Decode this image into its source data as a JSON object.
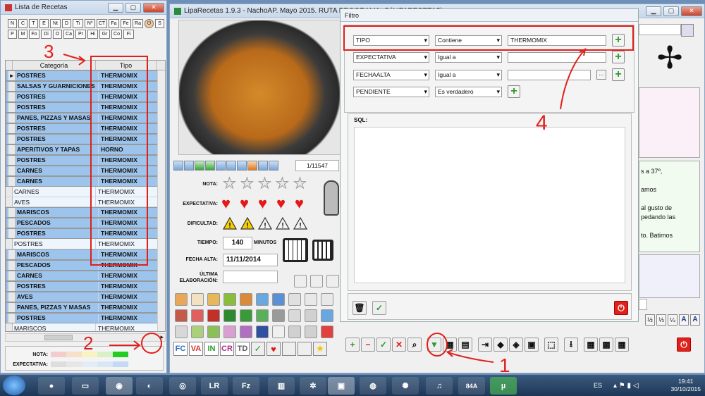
{
  "lista": {
    "title": "Lista de Recetas",
    "letters": [
      "N",
      "C",
      "T",
      "E",
      "Nt",
      "D",
      "Ti",
      "Nº",
      "CT",
      "Fa",
      "Fe",
      "Ra",
      "S",
      "P",
      "M",
      "Fo",
      "Di",
      "O",
      "Ca",
      "Pr",
      "Hi",
      "Gr",
      "Co",
      "Fi"
    ],
    "columns": [
      "Categoría",
      "Tipo"
    ],
    "rows": [
      {
        "cat": "POSTRES",
        "tipo": "THERMOMIX",
        "style": "sel"
      },
      {
        "cat": "SALSAS Y GUARNICIONES",
        "tipo": "THERMOMIX",
        "style": "sel"
      },
      {
        "cat": "POSTRES",
        "tipo": "THERMOMIX",
        "style": "sel"
      },
      {
        "cat": "POSTRES",
        "tipo": "THERMOMIX",
        "style": "sel"
      },
      {
        "cat": "PANES, PIZZAS Y MASAS",
        "tipo": "THERMOMIX",
        "style": "sel"
      },
      {
        "cat": "POSTRES",
        "tipo": "THERMOMIX",
        "style": "sel"
      },
      {
        "cat": "POSTRES",
        "tipo": "THERMOMIX",
        "style": "sel"
      },
      {
        "cat": "APERITIVOS Y TAPAS",
        "tipo": "HORNO",
        "style": "sel"
      },
      {
        "cat": "POSTRES",
        "tipo": "THERMOMIX",
        "style": "sel"
      },
      {
        "cat": "CARNES",
        "tipo": "THERMOMIX",
        "style": "sel"
      },
      {
        "cat": "CARNES",
        "tipo": "THERMOMIX",
        "style": "sel"
      },
      {
        "cat": "CARNES",
        "tipo": "THERMOMIX",
        "style": "plain"
      },
      {
        "cat": "AVES",
        "tipo": "THERMOMIX",
        "style": "plain"
      },
      {
        "cat": "MARISCOS",
        "tipo": "THERMOMIX",
        "style": "sel"
      },
      {
        "cat": "PESCADOS",
        "tipo": "THERMOMIX",
        "style": "sel"
      },
      {
        "cat": "POSTRES",
        "tipo": "THERMOMIX",
        "style": "sel"
      },
      {
        "cat": "POSTRES",
        "tipo": "THERMOMIX",
        "style": "plain"
      },
      {
        "cat": "MARISCOS",
        "tipo": "THERMOMIX",
        "style": "sel"
      },
      {
        "cat": "PESCADOS",
        "tipo": "THERMOMIX",
        "style": "sel"
      },
      {
        "cat": "CARNES",
        "tipo": "THERMOMIX",
        "style": "sel"
      },
      {
        "cat": "POSTRES",
        "tipo": "THERMOMIX",
        "style": "sel"
      },
      {
        "cat": "AVES",
        "tipo": "THERMOMIX",
        "style": "sel"
      },
      {
        "cat": "PANES, PIZZAS Y MASAS",
        "tipo": "THERMOMIX",
        "style": "sel"
      },
      {
        "cat": "POSTRES",
        "tipo": "THERMOMIX",
        "style": "sel"
      },
      {
        "cat": "MARISCOS",
        "tipo": "THERMOMIX",
        "style": "plain"
      }
    ],
    "legend": {
      "nota": "NOTA:",
      "expectativa": "EXPECTATIVA:"
    }
  },
  "main": {
    "title": "LipaRecetas 1.9.3 - NachoAP. Mayo 2015. RUTA PROGRAMA: C:\\LIPARECETAS\\",
    "counter": "1/11547",
    "labels": {
      "nota": "NOTA:",
      "expectativa": "EXPECTATIVA:",
      "dificultad": "DIFICULTAD:",
      "tiempo": "TIEMPO:",
      "minutos": "MINUTOS",
      "fecha_alta": "FECHA ALTA:",
      "ultima_elaboracion": "ÚLTIMA ELABORACIÓN:"
    },
    "tiempo_value": "140",
    "fecha_alta_value": "11/11/2014",
    "ultima_elaboracion_value": "",
    "nota_stars": 0,
    "expectativa_hearts": 5,
    "tags": [
      "FC",
      "VA",
      "IN",
      "CR",
      "TD"
    ]
  },
  "filtro": {
    "title": "Filtro",
    "rows": [
      {
        "field": "TIPO",
        "op": "Contiene",
        "value": "THERMOMIX",
        "has_dots": false
      },
      {
        "field": "EXPECTATIVA",
        "op": "Igual a",
        "value": "",
        "has_dots": false
      },
      {
        "field": "FECHAALTA",
        "op": "Igual a",
        "value": "",
        "has_dots": true
      },
      {
        "field": "PENDIENTE",
        "op": "Es verdadero",
        "value": null,
        "has_dots": false
      }
    ],
    "sql_label": "SQL:",
    "sql_text": ""
  },
  "right_pane": {
    "text_lines": [
      "s a 37º,",
      "",
      "amos",
      "",
      "al gusto de",
      "pedando las",
      "",
      "to. Batimos"
    ],
    "fraction_buttons": [
      "½",
      "⅓",
      "¼"
    ]
  },
  "annotations": [
    "3",
    "2",
    "4",
    "1"
  ],
  "taskbar": {
    "lang": "ES",
    "time": "19:41",
    "date": "30/10/2015",
    "apps": [
      "LR",
      "Fz",
      "84A"
    ]
  },
  "colors": {
    "selected_row": "#9dc4ec",
    "accent_red": "#e0201a",
    "heart": "#e21a1a"
  }
}
